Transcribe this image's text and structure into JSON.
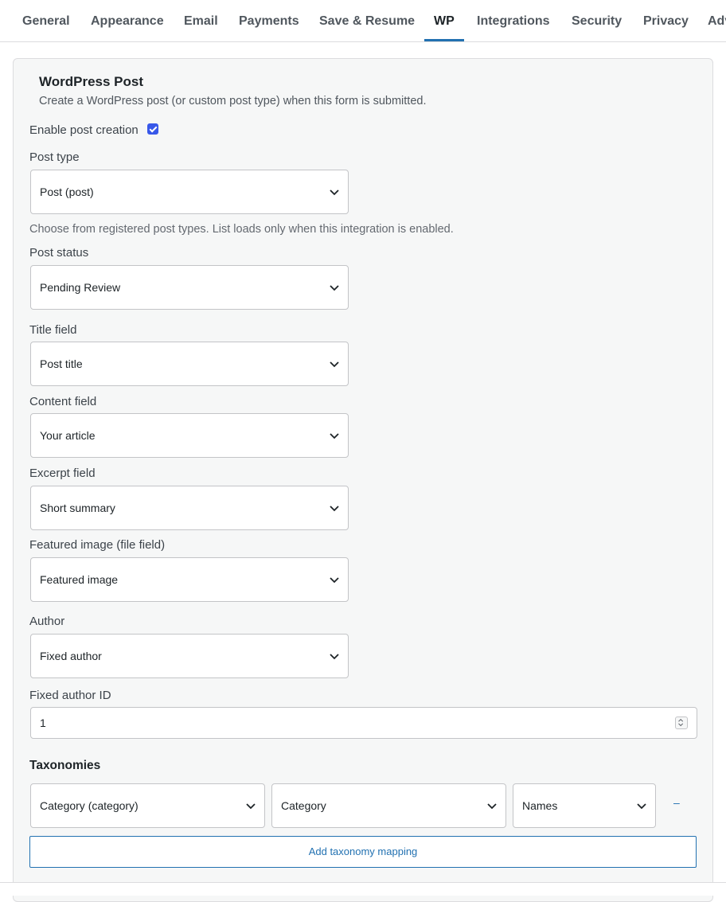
{
  "tabs": [
    {
      "label": "General"
    },
    {
      "label": "Appearance"
    },
    {
      "label": "Email"
    },
    {
      "label": "Payments"
    },
    {
      "label": "Save & Resume"
    },
    {
      "label": "WP"
    },
    {
      "label": "Integrations"
    },
    {
      "label": "Security"
    },
    {
      "label": "Privacy"
    },
    {
      "label": "Advanced"
    }
  ],
  "active_tab": "WP",
  "section": {
    "title": "WordPress Post",
    "description": "Create a WordPress post (or custom post type) when this form is submitted."
  },
  "enable": {
    "label": "Enable post creation",
    "checked": true
  },
  "post_type": {
    "label": "Post type",
    "value": "Post (post)",
    "help": "Choose from registered post types. List loads only when this integration is enabled."
  },
  "post_status": {
    "label": "Post status",
    "value": "Pending Review"
  },
  "title_field": {
    "label": "Title field",
    "value": "Post title"
  },
  "content_field": {
    "label": "Content field",
    "value": "Your article"
  },
  "excerpt_field": {
    "label": "Excerpt field",
    "value": "Short summary"
  },
  "featured_image": {
    "label": "Featured image (file field)",
    "value": "Featured image"
  },
  "author": {
    "label": "Author",
    "value": "Fixed author"
  },
  "fixed_author_id": {
    "label": "Fixed author ID",
    "value": "1"
  },
  "taxonomies": {
    "title": "Taxonomies",
    "rows": [
      {
        "taxonomy": "Category (category)",
        "field": "Category",
        "mode": "Names",
        "remove_label": "–"
      }
    ],
    "add_label": "Add taxonomy mapping"
  },
  "colors": {
    "accent": "#2271b1",
    "checkbox": "#3858e9"
  }
}
